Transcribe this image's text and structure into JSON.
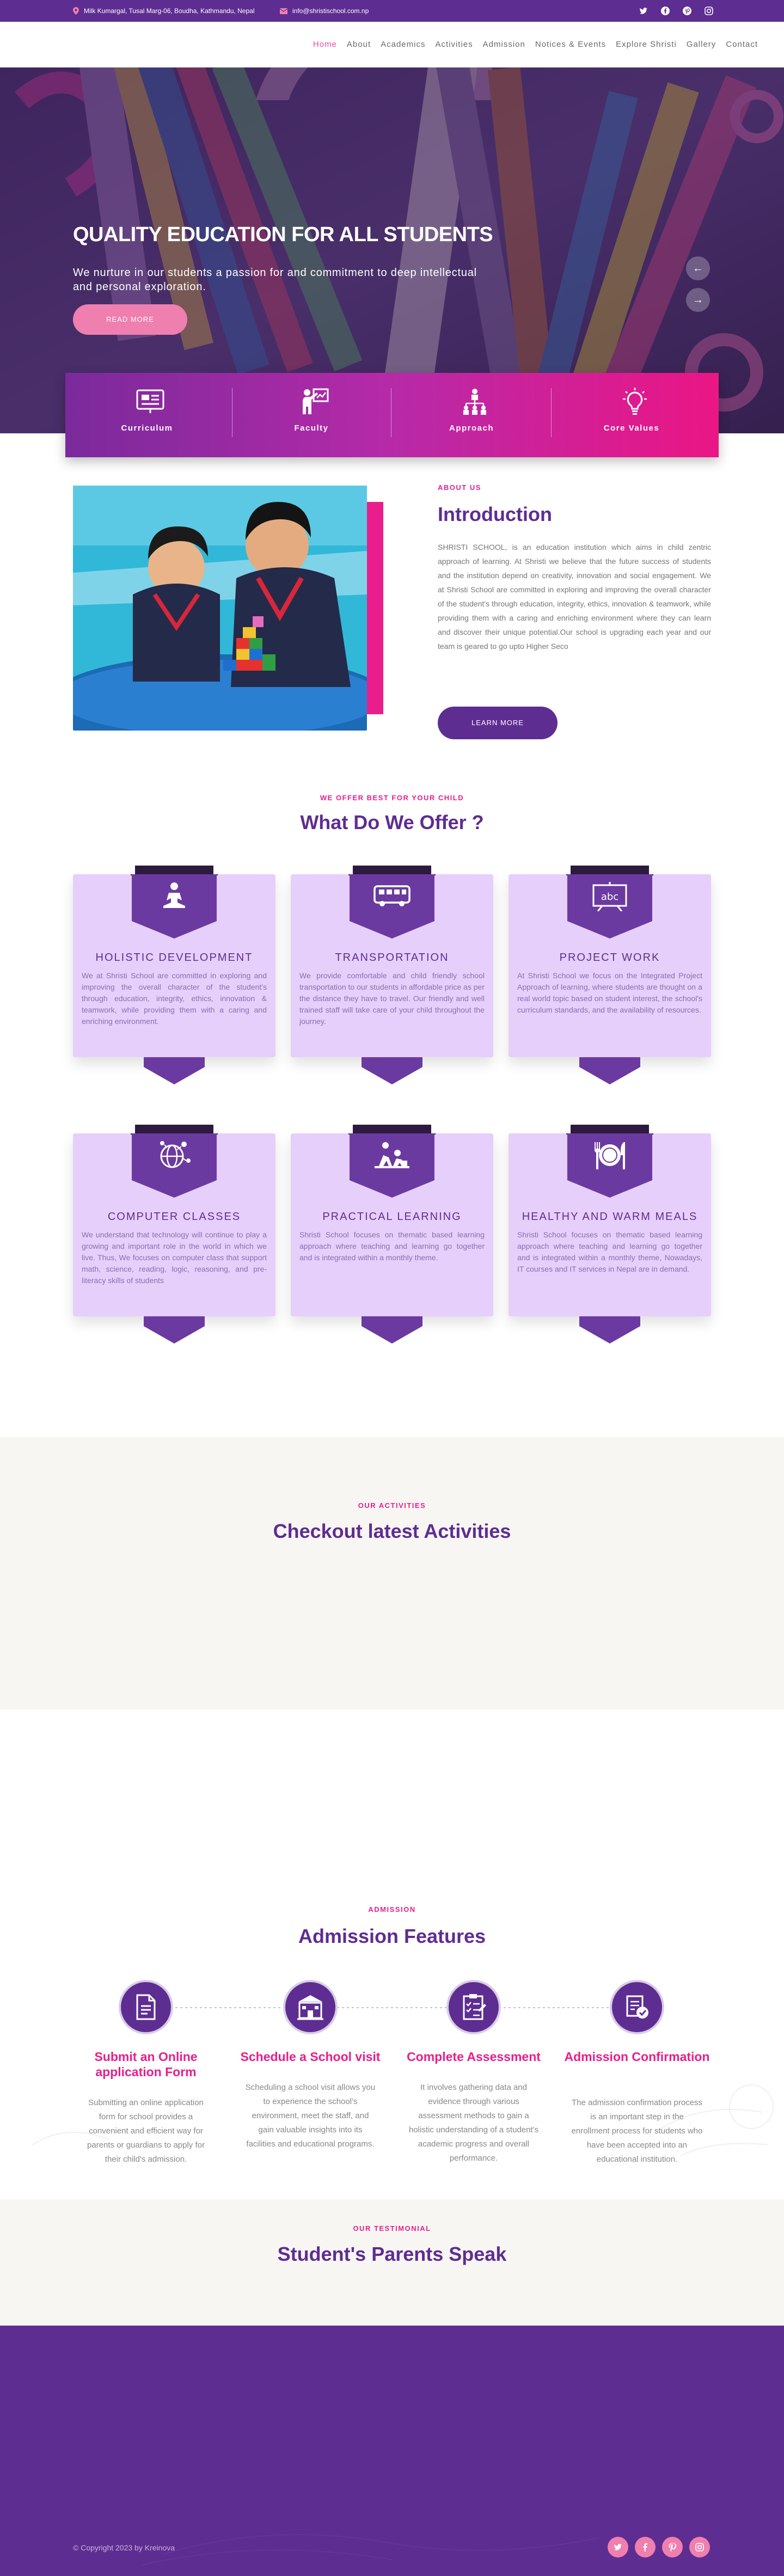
{
  "topbar": {
    "address": "Milk Kumargal, Tusal Marg-06, Boudha, Kathmandu, Nepal",
    "email": "info@shristischool.com.np",
    "social": [
      "twitter-icon",
      "facebook-icon",
      "pinterest-icon",
      "instagram-icon"
    ]
  },
  "nav": {
    "items": [
      "Home",
      "About",
      "Academics",
      "Activities",
      "Admission",
      "Notices & Events",
      "Explore Shristi",
      "Gallery",
      "Contact"
    ],
    "active_index": 0
  },
  "hero": {
    "title": "QUALITY EDUCATION FOR ALL STUDENTS",
    "subtitle": "We nurture in our students a passion for and commitment to deep intellectual and personal exploration.",
    "button": "READ MORE",
    "prev": "←",
    "next": "→"
  },
  "feature_bar": {
    "items": [
      {
        "label": "Curriculum",
        "icon": "presentation-icon"
      },
      {
        "label": "Faculty",
        "icon": "teacher-icon"
      },
      {
        "label": "Approach",
        "icon": "hierarchy-icon"
      },
      {
        "label": "Core Values",
        "icon": "lightbulb-icon"
      }
    ]
  },
  "intro": {
    "kicker": "ABOUT US",
    "title": "Introduction",
    "body": "SHRISTI SCHOOL, is an education institution which aims in child zentric approach of learning. At Shristi we believe that the future success of students and the institution depend on creativity, innovation and social engagement. We at Shristi School are committed in exploring and improving the overall character of the student's through education, integrity, ethics, innovation & teamwork, while providing them with a caring and enriching environment where they can learn and discover their unique potential.Our school is upgrading each year and our team is geared to go upto Higher Seco",
    "button": "LEARN MORE"
  },
  "offer": {
    "kicker": "WE OFFER BEST FOR YOUR CHILD",
    "title": "What Do We Offer ?",
    "cards": [
      {
        "title": "HOLISTIC DEVELOPMENT",
        "icon": "meditation-icon",
        "desc": "We at Shristi School are committed in exploring and improving the overall character of the student's through education, integrity, ethics, innovation & teamwork, while providing them with a caring and enriching environment."
      },
      {
        "title": "TRANSPORTATION",
        "icon": "bus-icon",
        "desc": "We provide comfortable and child friendly school transportation to our students in affordable price as per the distance they have to travel. Our friendly and well trained staff will take care of your child throughout the journey."
      },
      {
        "title": "PROJECT WORK",
        "icon": "abc-board-icon",
        "desc": "At Shristi School we focus on the Integrated Project Approach of learning, where students are thought on a real world topic based on student interest, the school's curriculum standards, and the availability of resources."
      },
      {
        "title": "COMPUTER CLASSES",
        "icon": "globe-network-icon",
        "desc": "We understand that technology will continue to play a growing and important role in the world in which we live. Thus, We focuses on computer class that support math, science, reading, logic, reasoning, and pre-literacy skills of students"
      },
      {
        "title": "PRACTICAL LEARNING",
        "icon": "kids-playing-icon",
        "desc": "Shristi School focuses on thematic based learning approach where teaching and learning go together and is integrated within a monthly theme."
      },
      {
        "title": "HEALTHY AND WARM MEALS",
        "icon": "plate-cutlery-icon",
        "desc": "Shristi School focuses on thematic based learning approach where teaching and learning go together and is integrated within a monthly theme, Nowadays, IT courses and IT services in Nepal are in demand."
      }
    ]
  },
  "activities": {
    "kicker": "OUR ACTIVITIES",
    "title": "Checkout latest Activities"
  },
  "admission": {
    "kicker": "ADMISSION",
    "title": "Admission Features",
    "steps": [
      {
        "title": "Submit an Online application Form",
        "icon": "document-icon",
        "desc": "Submitting an online application form for school provides a convenient and efficient way for parents or guardians to apply for their child's admission."
      },
      {
        "title": "Schedule a School visit",
        "icon": "school-building-icon",
        "desc": "Scheduling a school visit allows you to experience the school's environment, meet the staff, and gain valuable insights into its facilities and educational programs."
      },
      {
        "title": "Complete Assessment",
        "icon": "checklist-icon",
        "desc": "It involves gathering data and evidence through various assessment methods to gain a holistic understanding of a student's academic progress and overall performance."
      },
      {
        "title": "Admission Confirmation",
        "icon": "badge-check-icon",
        "desc": "The admission confirmation process is an important step in the enrollment process for students who have been accepted into an educational institution."
      }
    ]
  },
  "testimonial": {
    "kicker": "OUR TESTIMONIAL",
    "title": "Student's Parents Speak"
  },
  "footer": {
    "copyright": "© Copyright 2023 by Kreinova",
    "social": [
      "twitter-icon",
      "facebook-icon",
      "pinterest-icon",
      "instagram-icon"
    ]
  },
  "colors": {
    "purple": "#5e2d91",
    "pink": "#e91e8c",
    "light_pink": "#ef7fae",
    "card_bg": "#e6cffb"
  }
}
